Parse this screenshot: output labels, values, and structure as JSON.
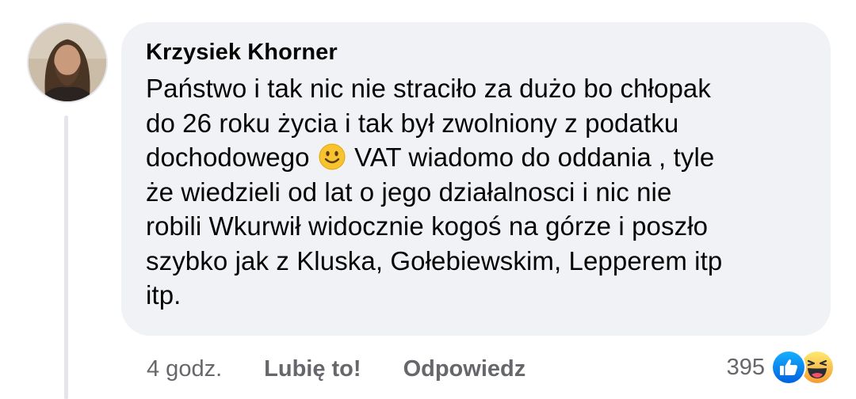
{
  "comment": {
    "author": "Krzysiek Khorner",
    "lines": [
      "Państwo i tak nic nie straciło za dużo bo chłopak",
      "do 26 roku życia i tak był zwolniony z podatku",
      "dochodowego",
      "VAT wiadomo do oddania , tyle",
      "że wiedzieli od lat o jego działalnosci i nic nie",
      "robili Wkurwił widocznie kogoś na górze i poszło",
      "szybko jak z Kluska, Gołebiewskim, Lepperem itp",
      "itp."
    ],
    "inline_emoji": "slightly-smiling-face"
  },
  "actions": {
    "time": "4 godz.",
    "like_label": "Lubię to!",
    "reply_label": "Odpowiedz"
  },
  "reactions": {
    "count": "395",
    "types": [
      "like",
      "haha"
    ]
  },
  "colors": {
    "bubble": "#f0f2f5",
    "text": "#050505",
    "meta": "#65676b",
    "like_blue": "#1877f2",
    "haha_yellow": "#f7b125"
  }
}
